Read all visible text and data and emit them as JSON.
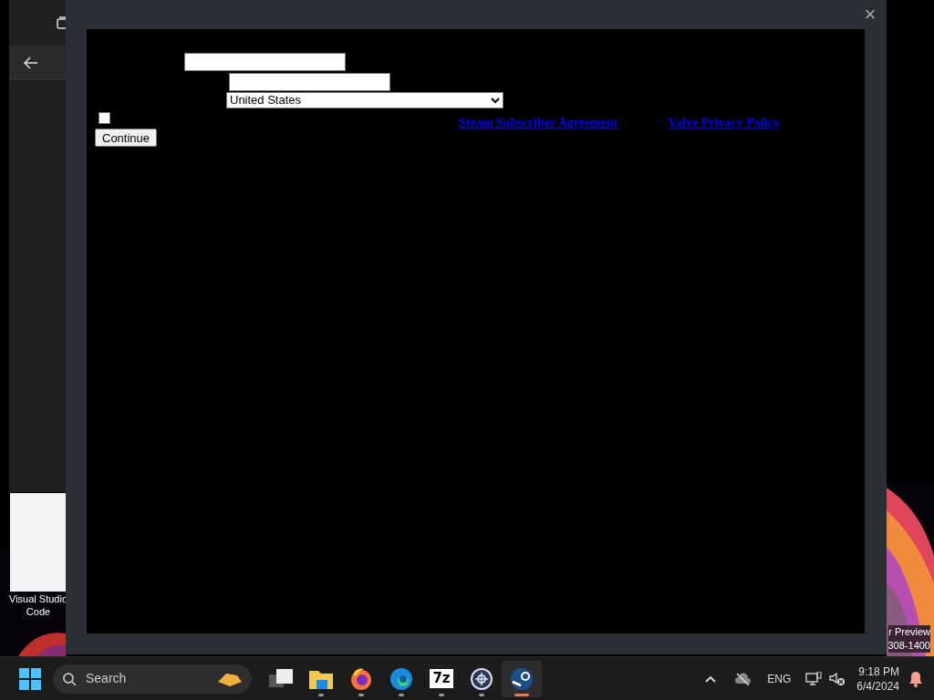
{
  "desktop_icon": {
    "label": "Visual Studio Code"
  },
  "desktop_watermark": [
    "r Preview",
    "308-1400"
  ],
  "dialog": {
    "close": "×",
    "form": {
      "fields": [
        {
          "kind": "text"
        },
        {
          "kind": "text"
        }
      ],
      "country": "United States",
      "agree_checkbox": {
        "checked": false
      },
      "links": [
        "Steam Subscriber Agreement",
        "Valve Privacy Policy"
      ],
      "button": "Continue"
    }
  },
  "taskbar": {
    "search": {
      "placeholder": "Search"
    },
    "apps": [
      {
        "kind": "task-view",
        "running": false,
        "selected": false
      },
      {
        "kind": "files",
        "running": true,
        "selected": false
      },
      {
        "kind": "firefox",
        "running": true,
        "selected": false
      },
      {
        "kind": "edge",
        "running": true,
        "selected": false
      },
      {
        "kind": "archiver",
        "label": "7z",
        "running": true,
        "selected": false
      },
      {
        "kind": "tool",
        "running": true,
        "selected": false
      },
      {
        "kind": "steam",
        "running": true,
        "selected": true
      }
    ],
    "tray": {
      "language": "ENG",
      "time": "9:18 PM",
      "date": "6/4/2024"
    }
  }
}
